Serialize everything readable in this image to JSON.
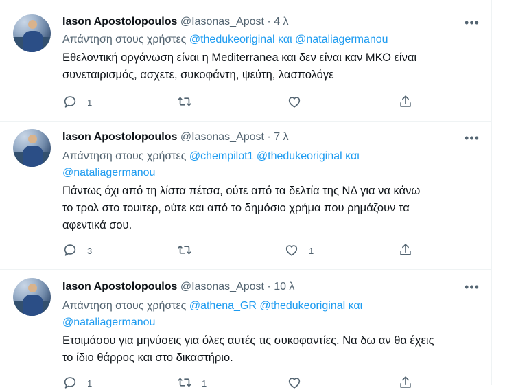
{
  "tweets": [
    {
      "author": "Iason Apostolopoulos",
      "handle": "@Iasonas_Apost",
      "dot": "·",
      "time": "4 λ",
      "reply_prefix": "Απάντηση στους χρήστες",
      "mentions": [
        "@thedukeoriginal",
        "και",
        "@nataliagermanou"
      ],
      "text_lines": [
        "Εθελοντική οργάνωση είναι η Mediterranea και δεν είναι καν ΜΚΟ είναι",
        "συνεταιρισμός, ασχετε, συκοφάντη, ψεύτη, λασπολόγε"
      ],
      "reply_count": "1",
      "retweet_count": "",
      "like_count": ""
    },
    {
      "author": "Iason Apostolopoulos",
      "handle": "@Iasonas_Apost",
      "dot": "·",
      "time": "7 λ",
      "reply_prefix": "Απάντηση στους χρήστες",
      "mentions": [
        "@chempilot1",
        "@thedukeoriginal",
        "και",
        "@nataliagermanou"
      ],
      "text_lines": [
        "Πάντως όχι από τη λίστα πέτσα, ούτε από τα δελτία της ΝΔ για να κάνω",
        "το τρολ στο τουιτερ, ούτε και από το δημόσιο χρήμα που ρημάζουν τα",
        "αφεντικά σου."
      ],
      "reply_count": "3",
      "retweet_count": "",
      "like_count": "1"
    },
    {
      "author": "Iason Apostolopoulos",
      "handle": "@Iasonas_Apost",
      "dot": "·",
      "time": "10 λ",
      "reply_prefix": "Απάντηση στους χρήστες",
      "mentions": [
        "@athena_GR",
        "@thedukeoriginal",
        "και",
        "@nataliagermanou"
      ],
      "text_lines": [
        "Ετοιμάσου για μηνύσεις για όλες αυτές τις συκοφαντίες. Να δω αν θα έχεις",
        "το ίδιο θάρρος και στο δικαστήριο."
      ],
      "reply_count": "1",
      "retweet_count": "1",
      "like_count": ""
    }
  ],
  "icons": {
    "more": "more-icon",
    "reply": "reply-icon",
    "retweet": "retweet-icon",
    "like": "like-icon",
    "share": "share-icon"
  },
  "colors": {
    "link": "#1d9bf0",
    "secondary_text": "#536471",
    "primary_text": "#0f1419",
    "divider": "#eff3f4"
  }
}
